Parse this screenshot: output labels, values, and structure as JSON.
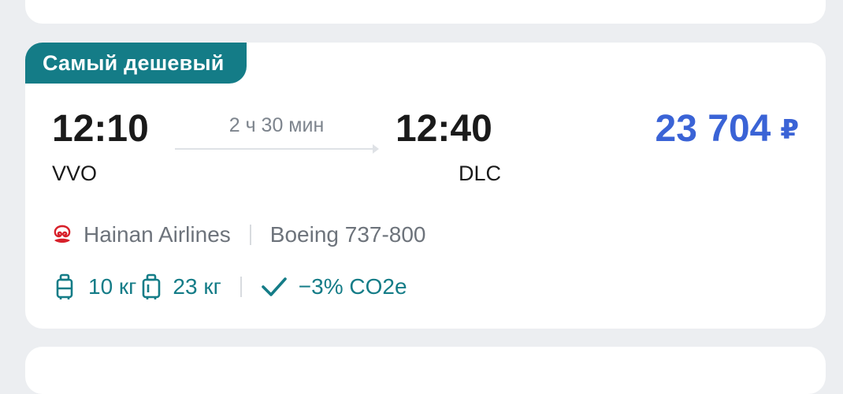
{
  "badge": {
    "label": "Самый дешевый"
  },
  "flight": {
    "departure_time": "12:10",
    "departure_code": "VVO",
    "arrival_time": "12:40",
    "arrival_code": "DLC",
    "duration": "2 ч 30 мин"
  },
  "price": {
    "amount": "23 704",
    "currency": "₽"
  },
  "airline": {
    "name": "Hainan Airlines",
    "aircraft": "Boeing 737-800",
    "logo_icon": "hainan-airlines-logo"
  },
  "baggage": {
    "hand_luggage": "10 кг",
    "checked_luggage": "23 кг",
    "co2": "−3% CO2e"
  },
  "colors": {
    "badge_bg": "#147c87",
    "price": "#3a63d6",
    "baggage_text": "#147c87",
    "airline_logo": "#d7202a"
  }
}
